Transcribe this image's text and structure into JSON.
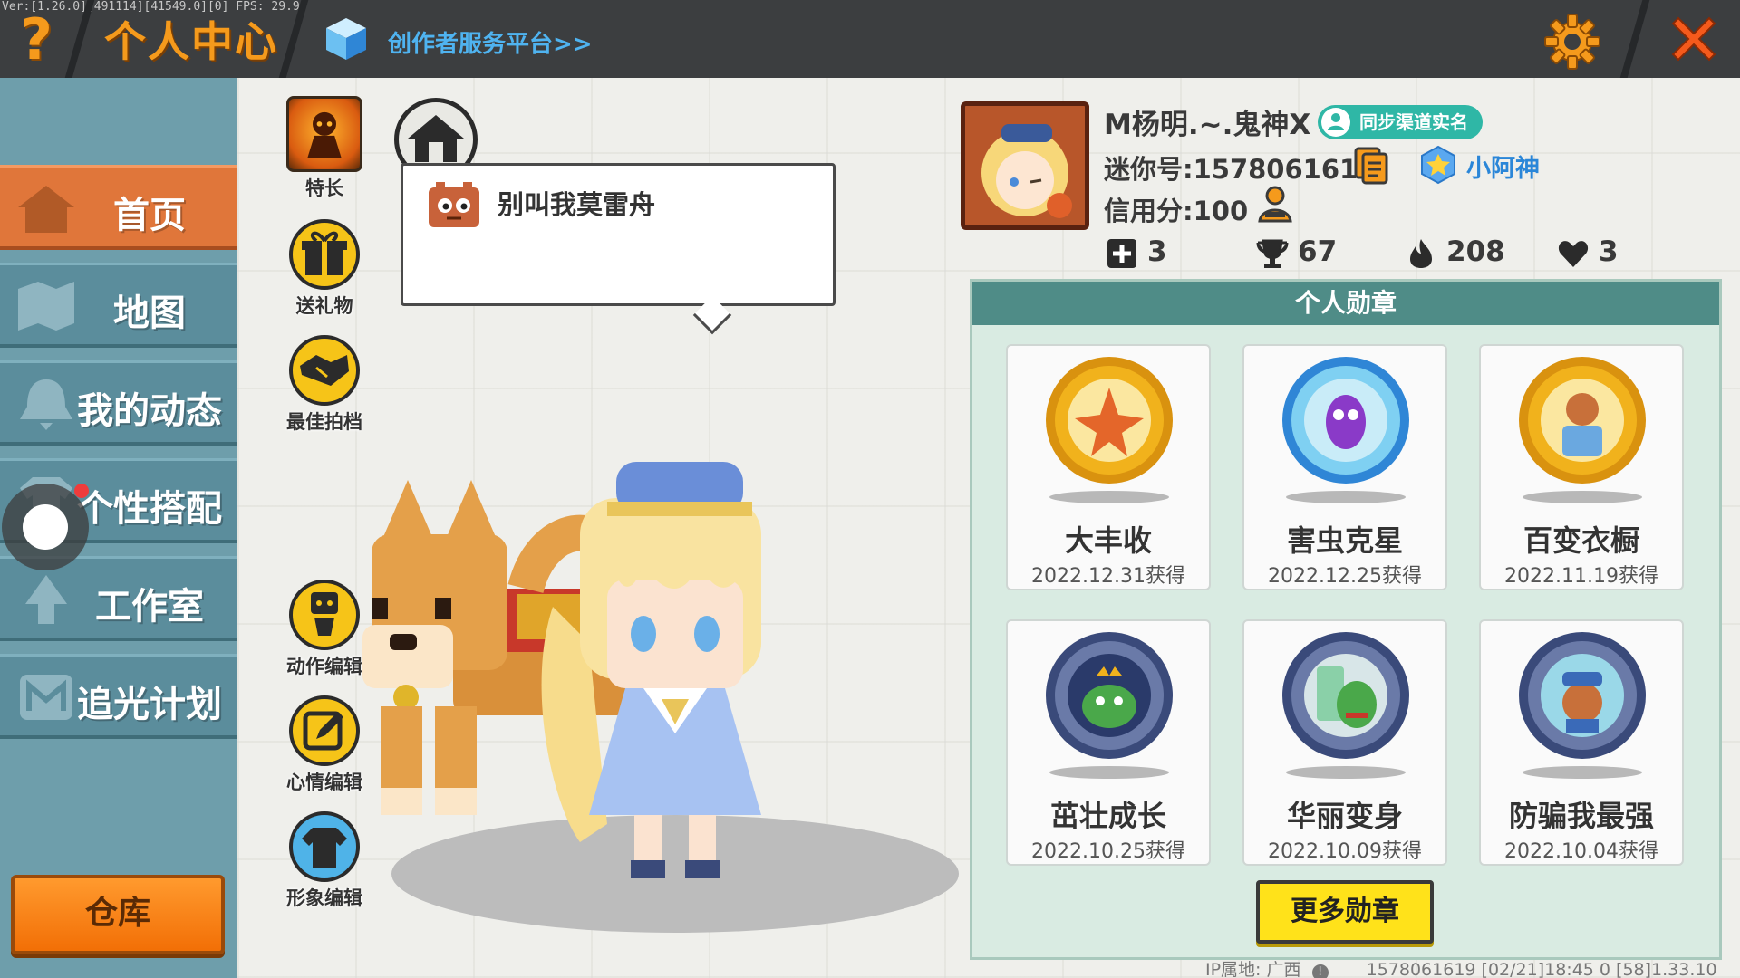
{
  "topbar": {
    "debug": "Ver:[1.26.0][491114][41549.0][0] FPS: 29.9",
    "help_glyph": "?",
    "title": "个人中心",
    "creator_link": "创作者服务平台>>",
    "accent": "#f59a1c"
  },
  "sidebar": {
    "items": [
      {
        "label": "首页",
        "icon": "house-icon",
        "active": true
      },
      {
        "label": "地图",
        "icon": "map-icon"
      },
      {
        "label": "我的动态",
        "icon": "bell-icon"
      },
      {
        "label": "个性搭配",
        "icon": "shirt-icon"
      },
      {
        "label": "工作室",
        "icon": "tree-icon"
      },
      {
        "label": "追光计划",
        "icon": "m-badge-icon"
      }
    ],
    "warehouse": "仓库"
  },
  "tools": {
    "talent": "特长",
    "gift": "送礼物",
    "partner": "最佳拍档",
    "action_edit": "动作编辑",
    "mood_edit": "心情编辑",
    "look_edit": "形象编辑"
  },
  "speech": {
    "text": "别叫我莫雷舟"
  },
  "profile": {
    "nickname": "M杨明.~.鬼神X",
    "sync_badge": "同步渠道实名",
    "mini_id": "迷你号:1578061619",
    "rank": "小阿神",
    "credit": "信用分:100",
    "stats": {
      "add": "3",
      "trophy": "67",
      "fire": "208",
      "likes": "3"
    }
  },
  "medals": {
    "header": "个人勋章",
    "items": [
      {
        "name": "大丰收",
        "date": "2022.12.31获得",
        "color": "#f1b21c"
      },
      {
        "name": "害虫克星",
        "date": "2022.12.25获得",
        "color": "#58b6e8"
      },
      {
        "name": "百变衣橱",
        "date": "2022.11.19获得",
        "color": "#f1b21c"
      },
      {
        "name": "茁壮成长",
        "date": "2022.10.25获得",
        "color": "#6a7aa8"
      },
      {
        "name": "华丽变身",
        "date": "2022.10.09获得",
        "color": "#6a7aa8"
      },
      {
        "name": "防骗我最强",
        "date": "2022.10.04获得",
        "color": "#6a7aa8"
      }
    ],
    "more": "更多勋章"
  },
  "footer": {
    "ip": "IP属地: 广西",
    "info": "1578061619    [02/21]18:45 0   [58]1.33.10"
  }
}
